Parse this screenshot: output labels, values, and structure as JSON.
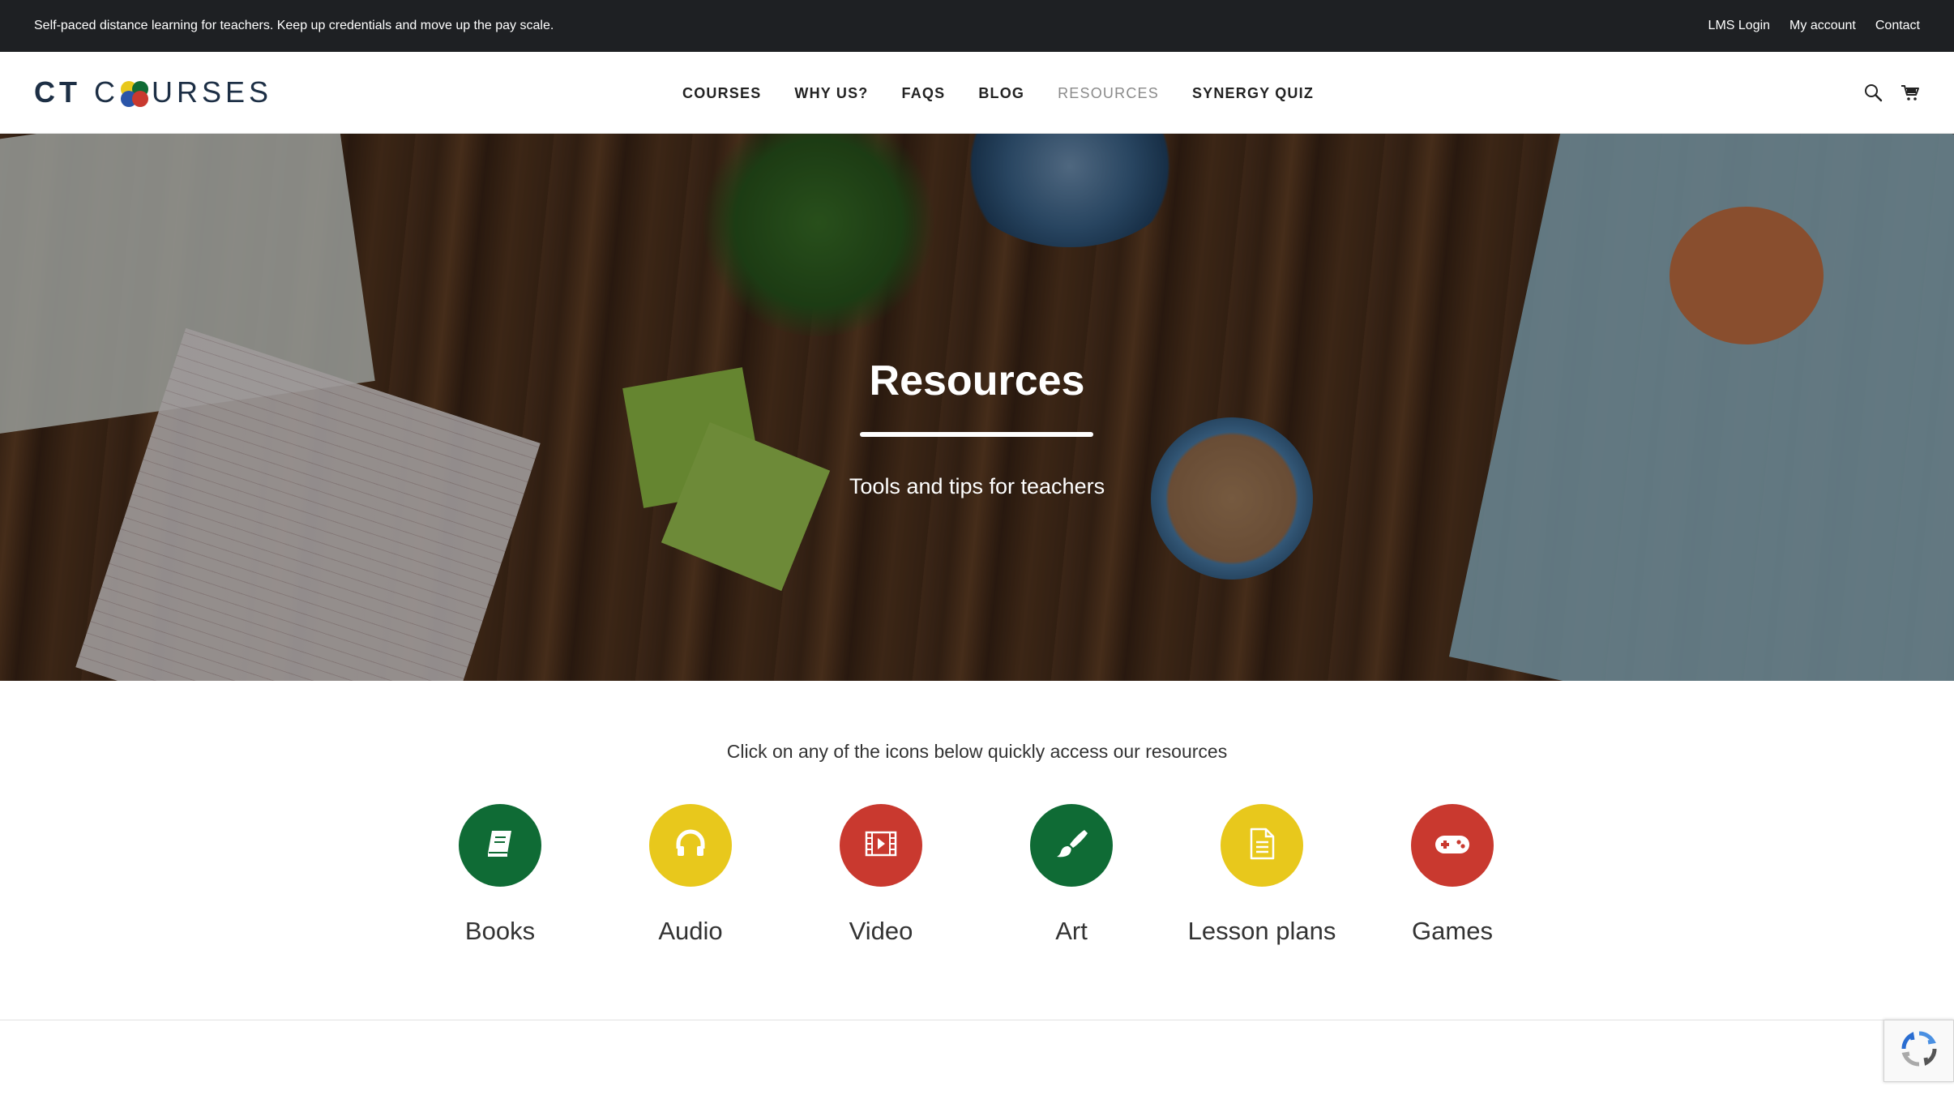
{
  "topbar": {
    "tagline": "Self-paced distance learning for teachers. Keep up credentials and move up the pay scale.",
    "links": [
      "LMS Login",
      "My account",
      "Contact"
    ]
  },
  "header": {
    "logo_ct": "CT",
    "logo_c": "C",
    "logo_rest": "URSES",
    "nav": [
      "COURSES",
      "WHY US?",
      "FAQS",
      "BLOG",
      "RESOURCES",
      "SYNERGY QUIZ"
    ],
    "active_nav": "RESOURCES",
    "icons": [
      "search-icon",
      "cart-icon"
    ]
  },
  "hero": {
    "title": "Resources",
    "subtitle": "Tools and tips for teachers"
  },
  "resources": {
    "intro": "Click on any of the icons below quickly access our resources",
    "items": [
      {
        "label": "Books",
        "icon": "book-icon",
        "color": "#0f6b35"
      },
      {
        "label": "Audio",
        "icon": "headphones-icon",
        "color": "#e8c81c"
      },
      {
        "label": "Video",
        "icon": "film-icon",
        "color": "#c9392f"
      },
      {
        "label": "Art",
        "icon": "paintbrush-icon",
        "color": "#0f6b35"
      },
      {
        "label": "Lesson plans",
        "icon": "document-icon",
        "color": "#e8c81c"
      },
      {
        "label": "Games",
        "icon": "gamepad-icon",
        "color": "#c9392f"
      }
    ]
  },
  "colors": {
    "topbar_bg": "#1e2023",
    "green": "#0f6b35",
    "yellow": "#e8c81c",
    "red": "#c9392f"
  }
}
